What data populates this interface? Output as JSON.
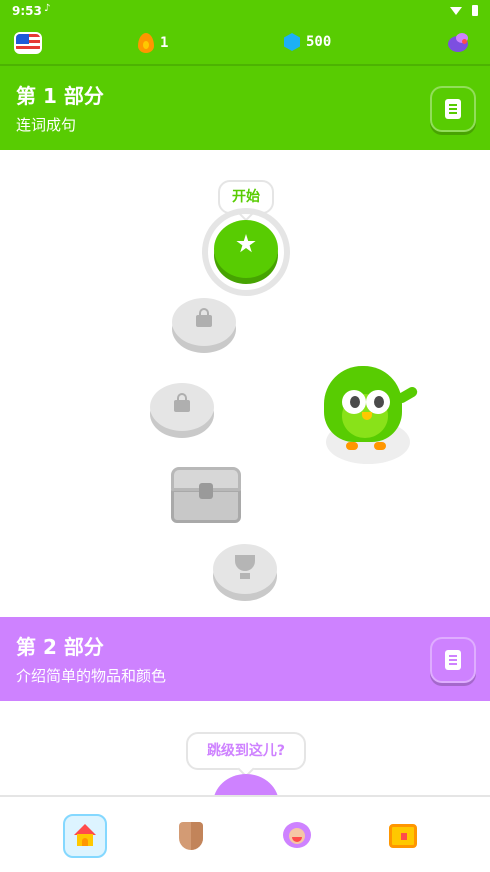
{
  "status_bar": {
    "time": "9:53",
    "notification_glyph": "♪"
  },
  "top_bar": {
    "course_flag": "us-flag-icon",
    "streak_count": "1",
    "gem_count": "500"
  },
  "units": [
    {
      "title": "第 1 部分",
      "subtitle": "连词成句",
      "color": "#58cc02"
    },
    {
      "title": "第 2 部分",
      "subtitle": "介绍简单的物品和颜色",
      "color": "#ce82ff"
    }
  ],
  "path": {
    "start_tooltip": "开始",
    "jump_tooltip": "跳级到这儿?"
  },
  "bottom_nav": {
    "items": [
      {
        "icon": "home-icon",
        "selected": true
      },
      {
        "icon": "leagues-shield-icon",
        "selected": false
      },
      {
        "icon": "profile-avatar-icon",
        "selected": false
      },
      {
        "icon": "shop-chest-icon",
        "selected": false
      }
    ]
  },
  "colors": {
    "green": "#58cc02",
    "purple": "#ce82ff",
    "locked_gray": "#e5e5e5"
  }
}
